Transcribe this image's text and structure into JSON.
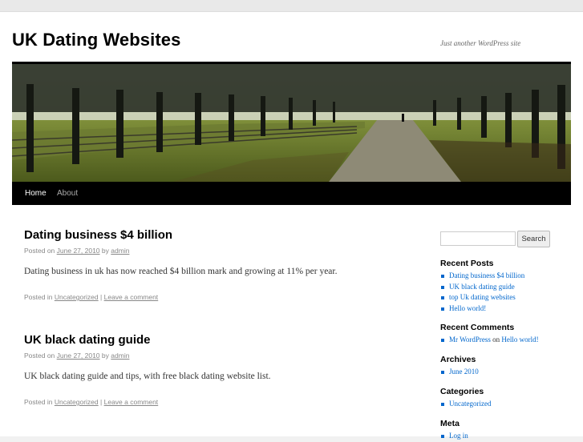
{
  "site": {
    "title": "UK Dating Websites",
    "tagline": "Just another WordPress site"
  },
  "nav": {
    "items": [
      {
        "label": "Home"
      },
      {
        "label": "About"
      }
    ]
  },
  "posts": [
    {
      "title": "Dating business $4 billion",
      "posted_on": "Posted on",
      "date": "June 27, 2010",
      "by": "by",
      "author": "admin",
      "body": "Dating business in uk has now reached $4 billion mark and growing at 11% per year.",
      "posted_in": "Posted in",
      "category": "Uncategorized",
      "separator": "|",
      "comment_link": "Leave a comment"
    },
    {
      "title": "UK black dating guide",
      "posted_on": "Posted on",
      "date": "June 27, 2010",
      "by": "by",
      "author": "admin",
      "body": "UK black dating guide and tips, with free black dating website list.",
      "posted_in": "Posted in",
      "category": "Uncategorized",
      "separator": "|",
      "comment_link": "Leave a comment"
    }
  ],
  "sidebar": {
    "search_button": "Search",
    "recent_posts": {
      "title": "Recent Posts",
      "items": [
        "Dating business $4 billion",
        "UK black dating guide",
        "top Uk dating websites",
        "Hello world!"
      ]
    },
    "recent_comments": {
      "title": "Recent Comments",
      "author": "Mr WordPress",
      "on": "on",
      "post": "Hello world!"
    },
    "archives": {
      "title": "Archives",
      "items": [
        "June 2010"
      ]
    },
    "categories": {
      "title": "Categories",
      "items": [
        "Uncategorized"
      ]
    },
    "meta": {
      "title": "Meta",
      "items": [
        "Log in"
      ]
    }
  }
}
